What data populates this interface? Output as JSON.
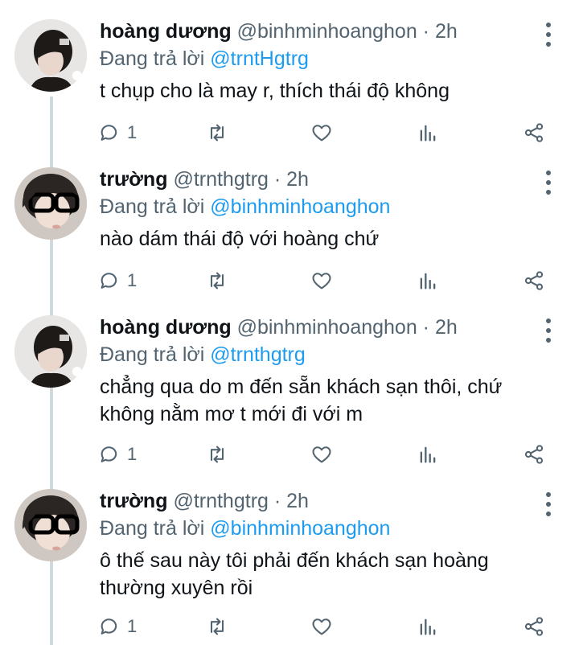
{
  "replying_prefix": "Đang trả lời",
  "tweets": [
    {
      "name": "hoàng dương",
      "handle": "@binhminhoanghon · 2h",
      "reply_to": "@trntHgtrg",
      "text": "t chụp cho là may r, thích thái độ không",
      "reply_count": "1"
    },
    {
      "name": "trường",
      "handle": "@trnthgtrg · 2h",
      "reply_to": "@binhminhoanghon",
      "text": "nào dám thái độ với hoàng chứ",
      "reply_count": "1"
    },
    {
      "name": "hoàng dương",
      "handle": "@binhminhoanghon · 2h",
      "reply_to": "@trnthgtrg",
      "text": "chẳng qua do m đến sẵn khách sạn thôi, chứ không nằm mơ t mới đi với m",
      "reply_count": "1"
    },
    {
      "name": "trường",
      "handle": "@trnthgtrg · 2h",
      "reply_to": "@binhminhoanghon",
      "text": "ô thế sau này tôi phải đến khách sạn hoàng thường xuyên rồi",
      "reply_count": "1"
    }
  ],
  "icons": {
    "reply": "reply-icon",
    "retweet": "retweet-icon",
    "like": "heart-icon",
    "views": "analytics-icon",
    "share": "share-icon",
    "more": "more-icon"
  },
  "colors": {
    "mention": "#1d9bf0",
    "secondary_text": "#536471",
    "thread_line": "#cfd9de"
  }
}
